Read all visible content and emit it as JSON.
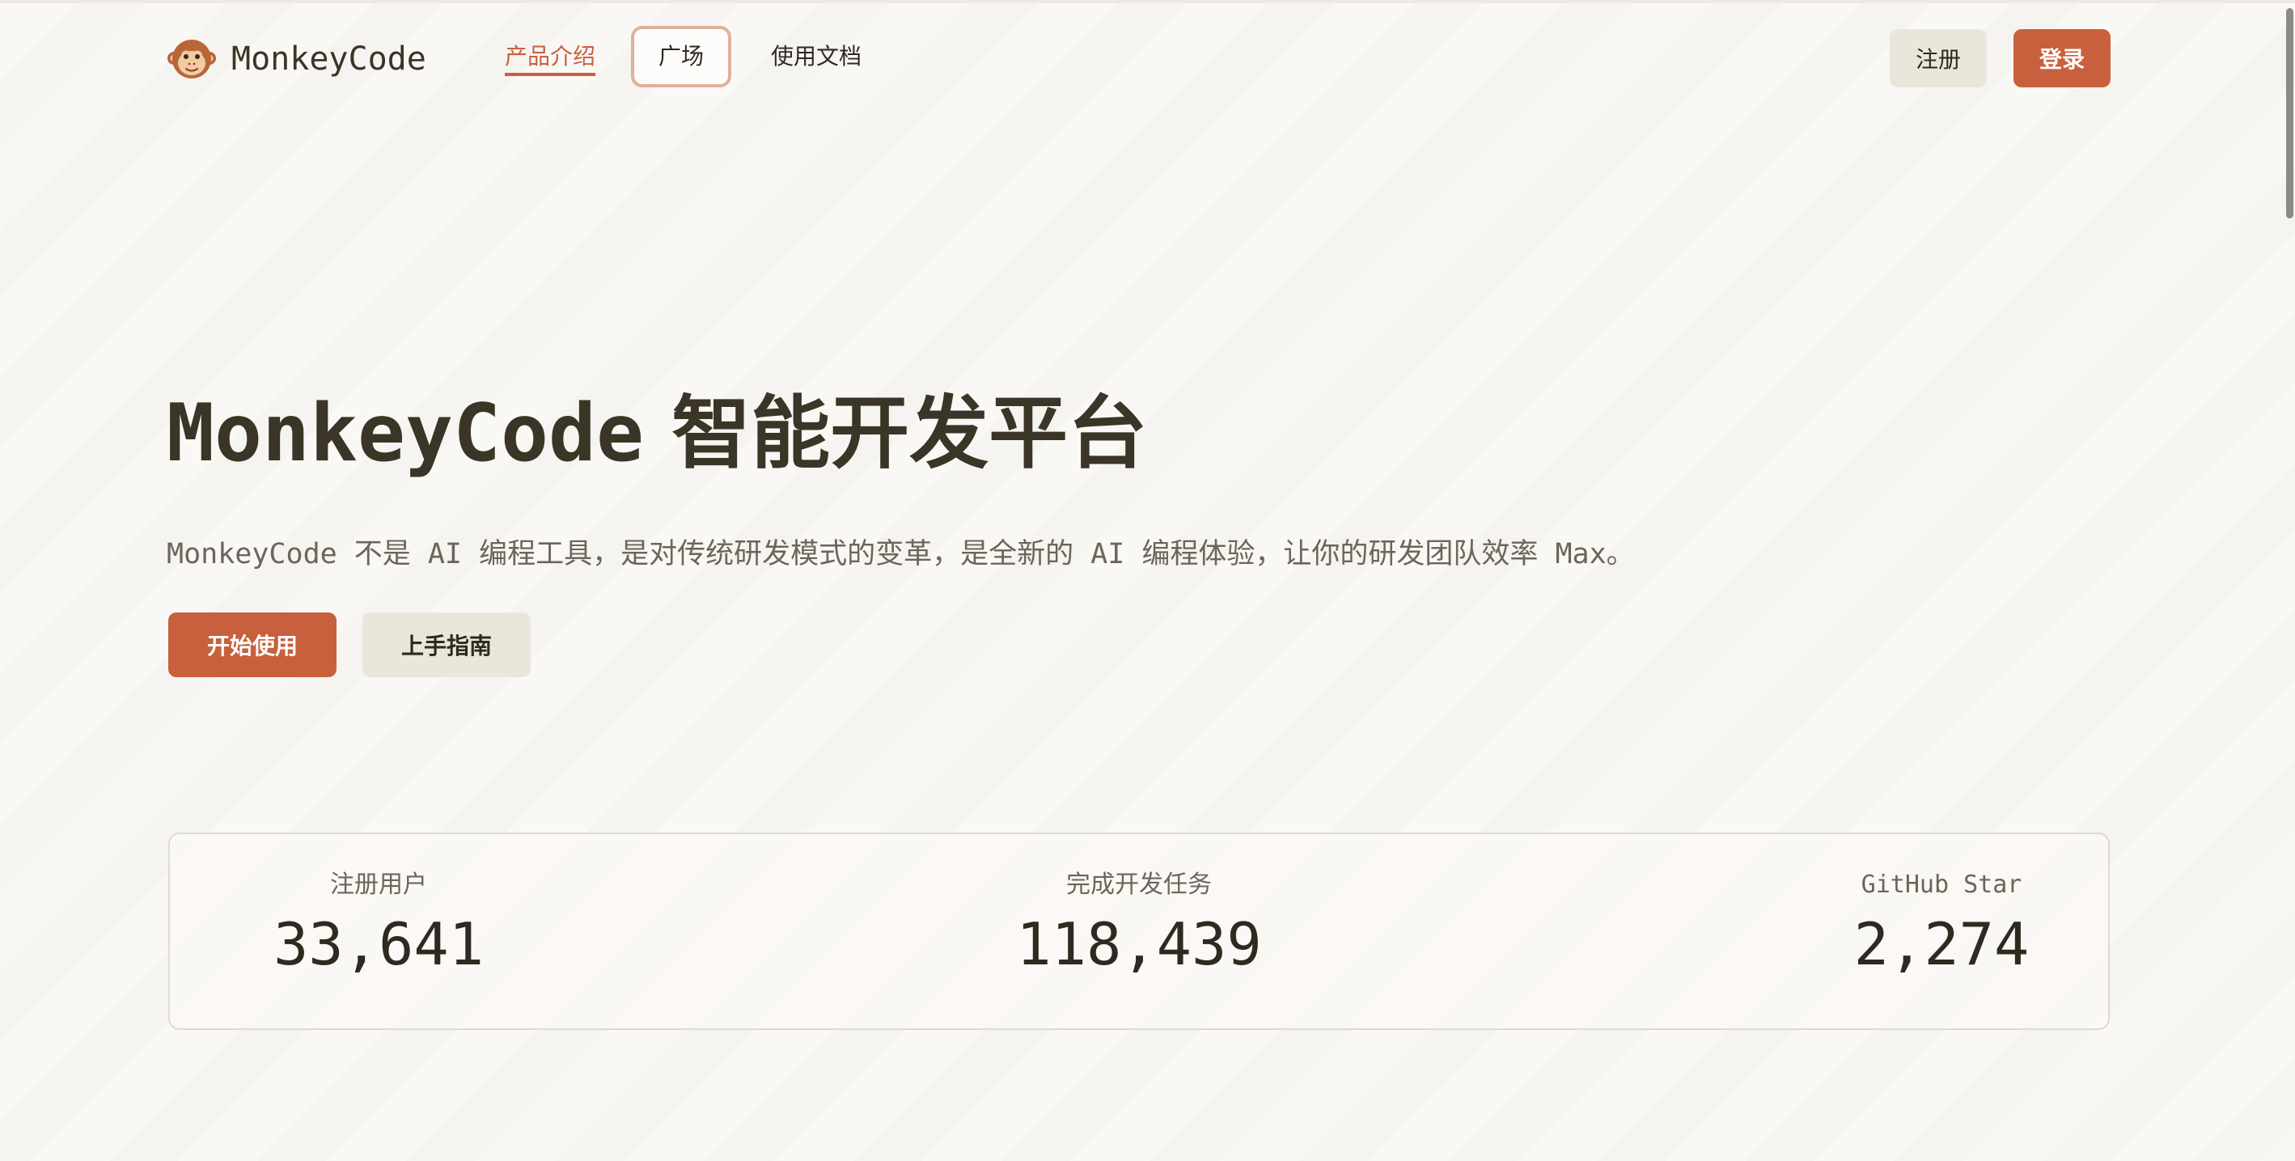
{
  "header": {
    "logo_text": "MonkeyCode",
    "nav": [
      {
        "label": "产品介绍",
        "active": true
      },
      {
        "label": "广场",
        "focused": true
      },
      {
        "label": "使用文档"
      }
    ],
    "register_label": "注册",
    "login_label": "登录"
  },
  "hero": {
    "title_brand": "MonkeyCode",
    "title_rest": "智能开发平台",
    "subtitle": "MonkeyCode 不是 AI 编程工具，是对传统研发模式的变革，是全新的 AI 编程体验，让你的研发团队效率 Max。",
    "start_label": "开始使用",
    "guide_label": "上手指南"
  },
  "stats": [
    {
      "label": "注册用户",
      "value": "33,641"
    },
    {
      "label": "完成开发任务",
      "value": "118,439"
    },
    {
      "label": "GitHub Star",
      "value": "2,274"
    }
  ],
  "colors": {
    "accent": "#c8603d",
    "background": "#faf8f5",
    "secondary_button": "#e9e6dc",
    "text_dark": "#3a3526"
  },
  "icons": {
    "logo": "monkey-face-icon"
  }
}
